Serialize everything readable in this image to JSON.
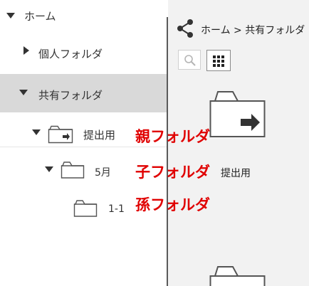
{
  "tree": {
    "home_label": "ホーム",
    "personal_label": "個人フォルダ",
    "shared_label": "共有フォルダ",
    "submit_label": "提出用",
    "may_label": "5月",
    "sub_label": "1-1"
  },
  "right_pane": {
    "breadcrumb_home": "ホーム",
    "breadcrumb_sep": ">",
    "breadcrumb_current": "共有フォルダ",
    "file_label": "提出用"
  },
  "annotations": {
    "parent": "親フォルダ",
    "child": "子フォルダ",
    "grandchild": "孫フォルダ"
  },
  "colors": {
    "annotation": "#e00000",
    "selected_bg": "#d9d9d9",
    "pane_bg": "#f2f2f2"
  }
}
